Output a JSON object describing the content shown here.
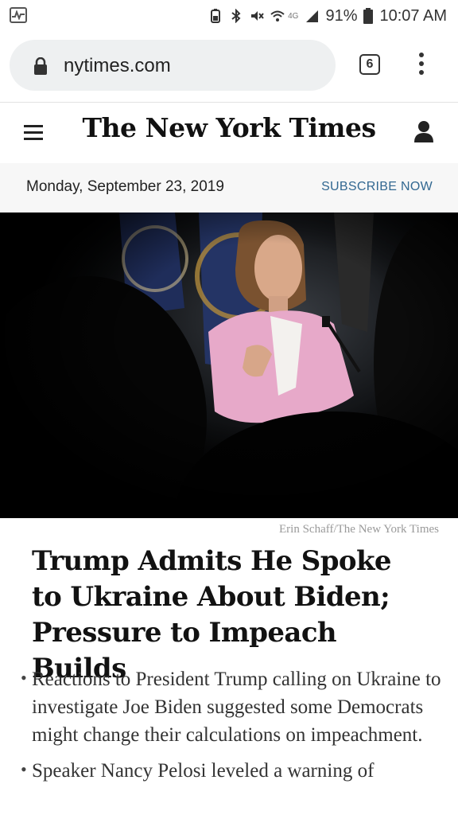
{
  "status_bar": {
    "network": "4G",
    "battery": "91%",
    "time": "10:07 AM"
  },
  "browser": {
    "url": "nytimes.com",
    "tab_count": "6"
  },
  "site": {
    "logo": "The New York Times"
  },
  "dateline": {
    "date": "Monday, September 23, 2019",
    "subscribe": "SUBSCRIBE NOW"
  },
  "article": {
    "photo_credit": "Erin Schaff/The New York Times",
    "headline": "Trump Admits He Spoke to Ukraine About Biden; Pressure to Impeach Builds",
    "bullets": [
      "Reactions to President Trump calling on Ukraine to investigate Joe Biden suggested some Democrats might change their calculations on impeachment.",
      "Speaker Nancy Pelosi leveled a warning of"
    ]
  },
  "colors": {
    "accent_link": "#326891",
    "headline": "#121212",
    "hero_jacket": "#e7a9c9"
  }
}
